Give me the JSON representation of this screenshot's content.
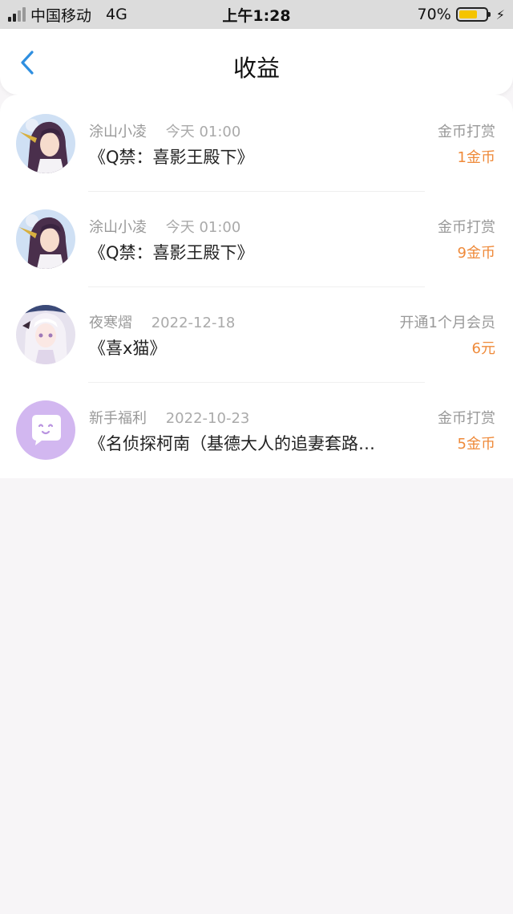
{
  "status_bar": {
    "carrier": "中国移动",
    "network": "4G",
    "time": "上午1:28",
    "battery_percent": "70%",
    "battery_level": 0.7,
    "signal_bars_on": 2,
    "signal_bars_total": 4,
    "charging_icon": "⚡"
  },
  "header": {
    "title": "收益",
    "back_icon": "chevron-left-icon"
  },
  "colors": {
    "accent": "#2f8fe0",
    "amount": "#ef8a3a",
    "battery": "#f5c400",
    "welfare_avatar": "#d2b7f0"
  },
  "items": [
    {
      "avatar": "anime-girl-avatar",
      "username": "涂山小凌",
      "date": "今天 01:00",
      "book_title": "《Q禁：喜影王殿下》",
      "reward_type": "金币打赏",
      "amount": "1金币"
    },
    {
      "avatar": "anime-girl-avatar",
      "username": "涂山小凌",
      "date": "今天 01:00",
      "book_title": "《Q禁：喜影王殿下》",
      "reward_type": "金币打赏",
      "amount": "9金币"
    },
    {
      "avatar": "white-hair-girl-avatar",
      "username": "夜寒熠",
      "date": "2022-12-18",
      "book_title": "《喜x猫》",
      "reward_type": "开通1个月会员",
      "amount": "6元"
    },
    {
      "avatar": "chat-bubble-avatar",
      "username": "新手福利",
      "date": "2022-10-23",
      "book_title": "《名侦探柯南（基德大人的追妻套路…",
      "reward_type": "金币打赏",
      "amount": "5金币"
    }
  ]
}
